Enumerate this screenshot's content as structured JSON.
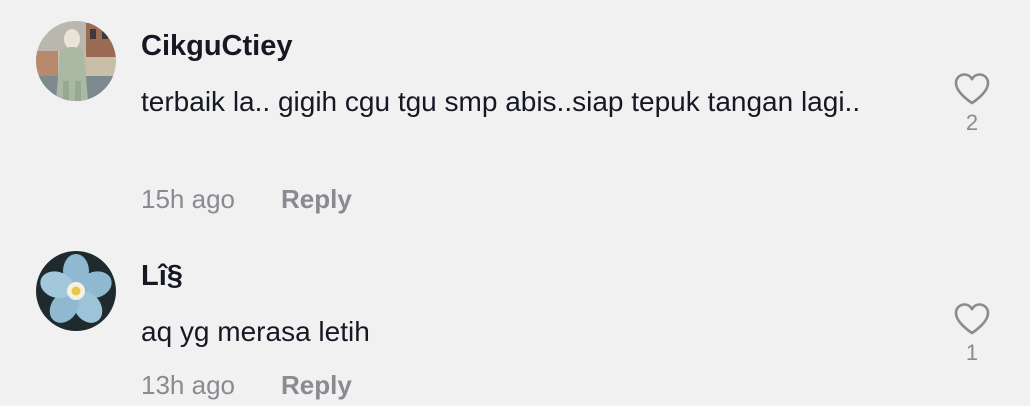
{
  "comments": [
    {
      "username": "CikguCtiey",
      "text": "terbaik la.. gigih cgu tgu smp abis..siap tepuk tangan lagi..",
      "time": "15h ago",
      "reply_label": "Reply",
      "like_count": "2",
      "like_icon": "heart-outline-icon"
    },
    {
      "username": "Lî§",
      "text": "aq yg merasa letih",
      "time": "13h ago",
      "reply_label": "Reply",
      "like_count": "1",
      "like_icon": "heart-outline-icon"
    }
  ]
}
